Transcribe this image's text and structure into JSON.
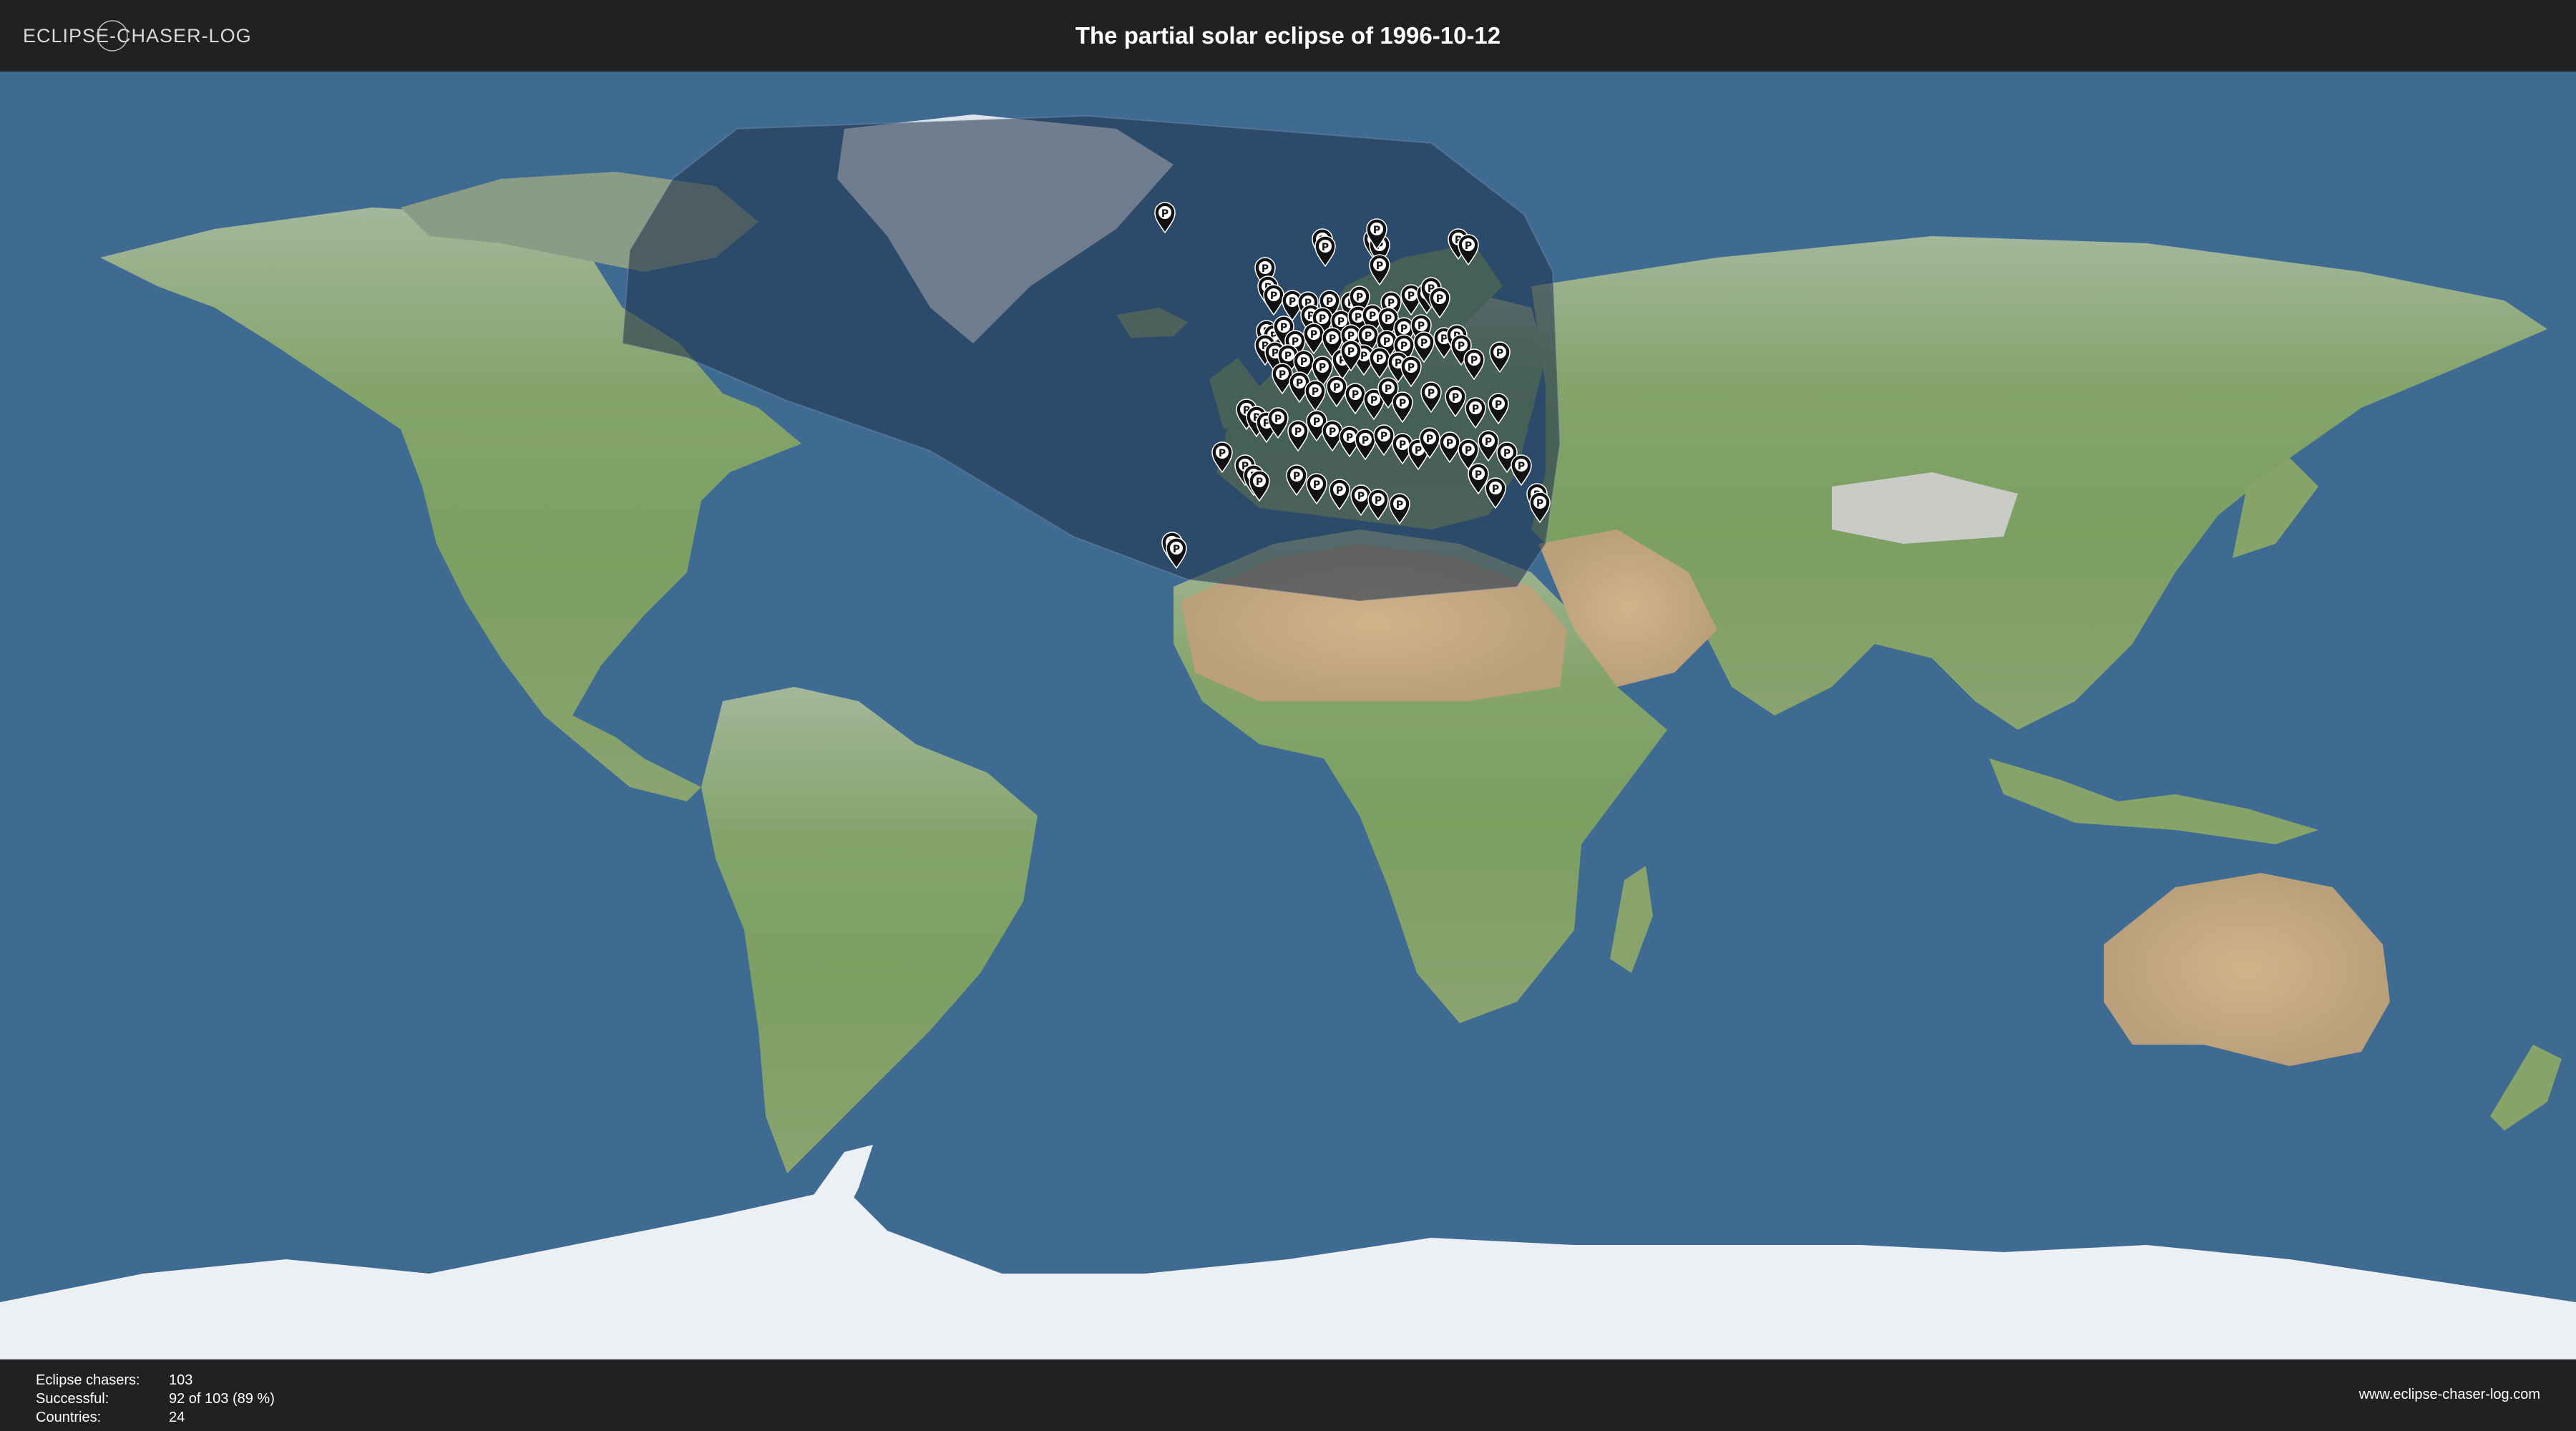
{
  "header": {
    "logo_text": "ECLIPSE-CHASER-LOG",
    "title": "The partial solar eclipse of 1996-10-12"
  },
  "map": {
    "ocean_color": "#3f6b93",
    "land_color": "#7fa06a",
    "desert_color": "#c7a882",
    "ice_color": "#e9eef3",
    "eclipse_shadow_color": "#2a3c55",
    "marker_icon": "map-pin-icon",
    "marker_glyph": "P",
    "markers_total": 103
  },
  "footer": {
    "stats": [
      {
        "label": "Eclipse chasers:",
        "value": "103"
      },
      {
        "label": "Successful:",
        "value": "92 of 103 (89 %)"
      },
      {
        "label": "Countries:",
        "value": "24"
      }
    ],
    "website": "www.eclipse-chaser-log.com"
  }
}
